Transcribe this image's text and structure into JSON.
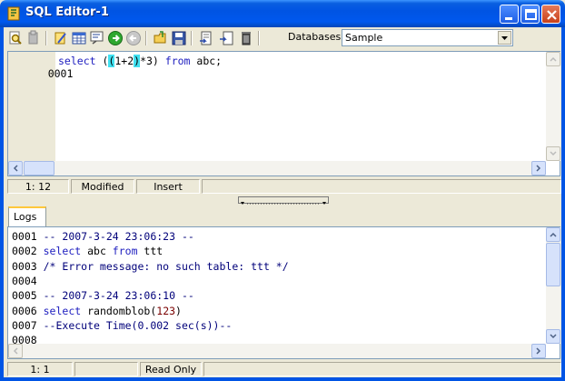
{
  "window": {
    "title": "SQL Editor-1"
  },
  "toolbar": {
    "database_label": "Databases",
    "database_value": "Sample"
  },
  "editor": {
    "lines": [
      {
        "num": "0001",
        "code": "select ((1+2)*3) from abc;"
      }
    ]
  },
  "editor_status": {
    "position": "1: 12",
    "state": "Modified",
    "mode": "Insert"
  },
  "tabs": [
    {
      "label": "Logs"
    }
  ],
  "logs": {
    "lines": [
      {
        "num": "0001",
        "text": "-- 2007-3-24 23:06:23 --"
      },
      {
        "num": "0002",
        "text": "select abc from ttt"
      },
      {
        "num": "0003",
        "text": "/* Error message: no such table: ttt */"
      },
      {
        "num": "0004",
        "text": ""
      },
      {
        "num": "0005",
        "text": "-- 2007-3-24 23:06:10 --"
      },
      {
        "num": "0006",
        "text": "select randomblob(123)"
      },
      {
        "num": "0007",
        "text": "--Execute Time(0.002 sec(s))--"
      },
      {
        "num": "0008",
        "text": ""
      }
    ]
  },
  "logs_status": {
    "position": "1: 1",
    "mode": "Read Only"
  },
  "colors": {
    "titlebar": "#0054e3",
    "keyword": "#2020c0",
    "bracket_highlight": "#40e0f0",
    "tab_accent": "#ffc83c"
  }
}
